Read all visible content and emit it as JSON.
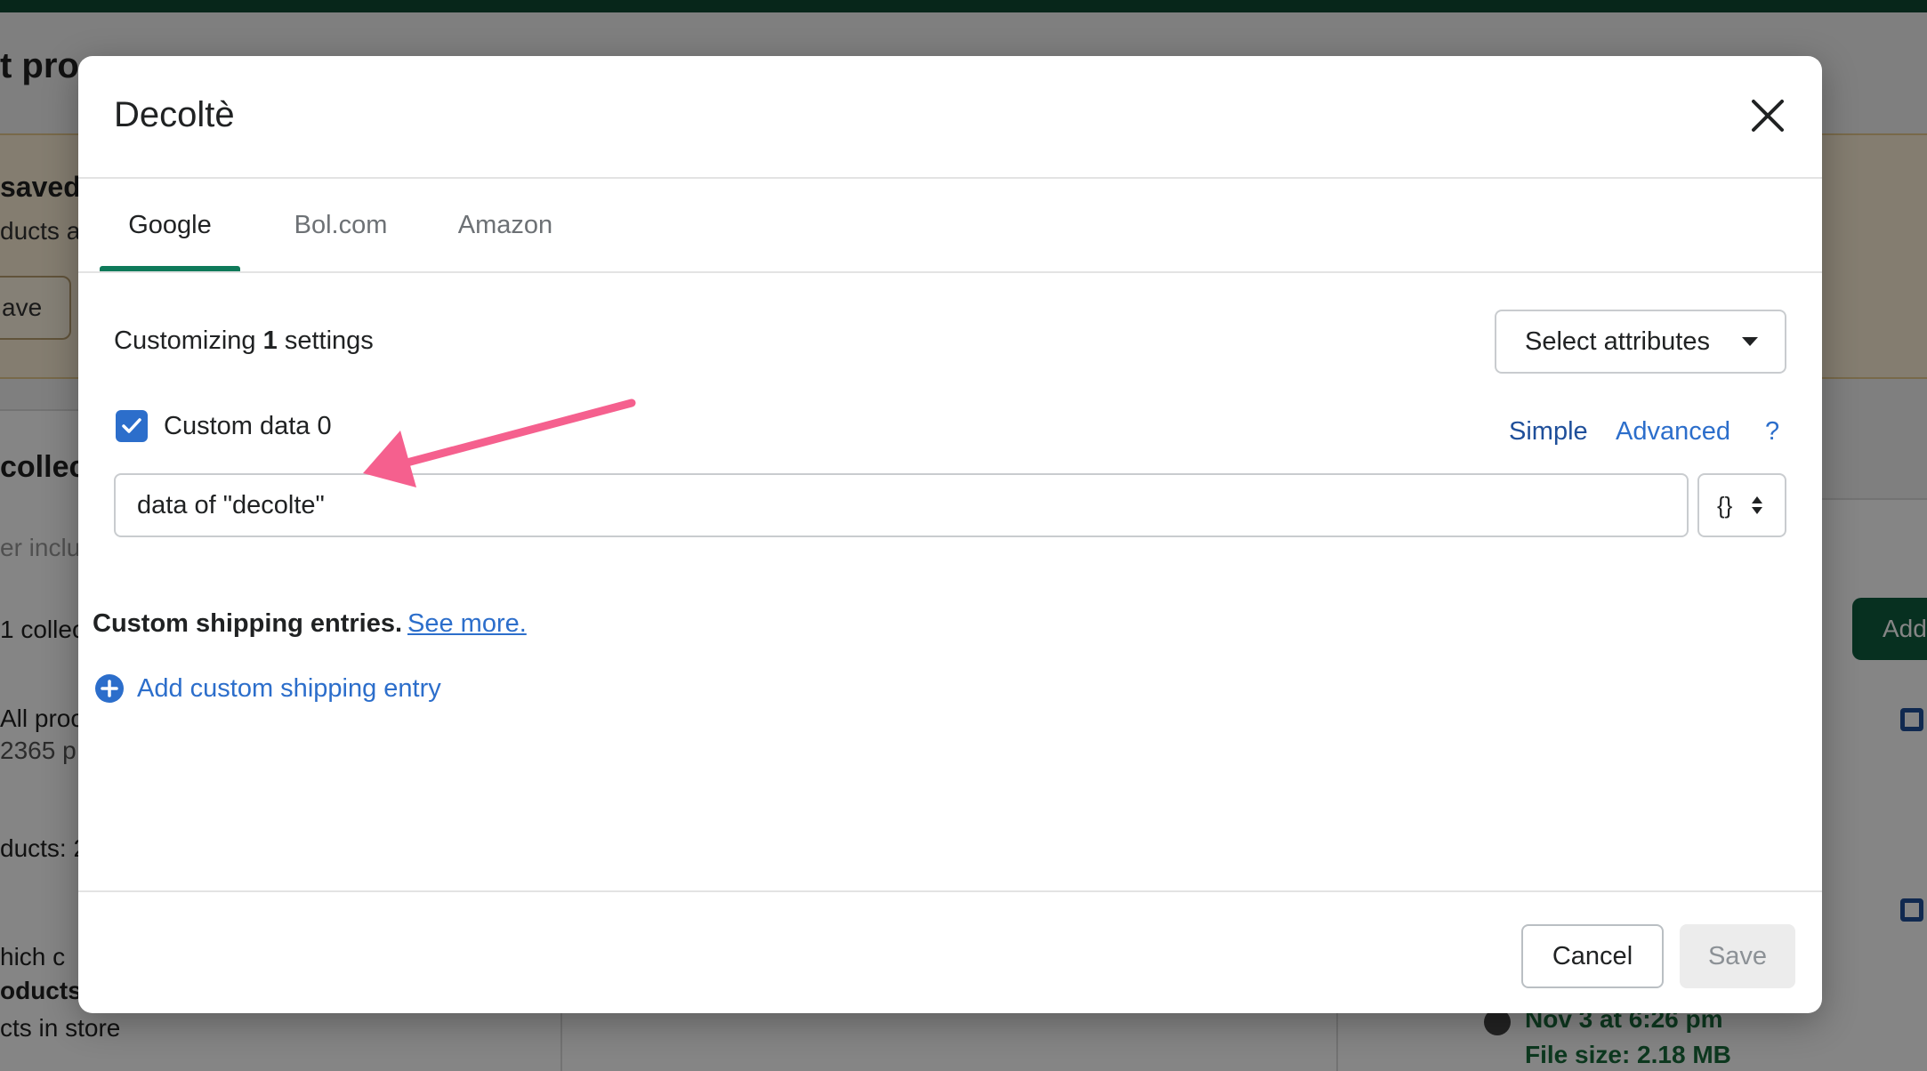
{
  "background": {
    "title_fragment": "t pro",
    "banner_saved": "saved",
    "banner_products": "ducts a",
    "banner_save_button": "ave",
    "collections_heading": "collec",
    "search_hint": "er inclu",
    "collections_count": "1 collec",
    "all_products": "All proc",
    "products_count": "2365 p",
    "products_label": "ducts: 2",
    "which_text": "hich c",
    "products_bold": "oducts",
    "products_in_store": "cts in store",
    "add_button": "Add",
    "date": "Nov 3 at 6:26 pm",
    "file_size": "File size: 2.18 MB"
  },
  "modal": {
    "title": "Decoltè",
    "tabs": [
      {
        "label": "Google",
        "active": true
      },
      {
        "label": "Bol.com",
        "active": false
      },
      {
        "label": "Amazon",
        "active": false
      }
    ],
    "customizing_prefix": "Customizing",
    "customizing_count": "1",
    "customizing_suffix": "settings",
    "select_attributes_label": "Select attributes",
    "custom_data": {
      "checked": true,
      "label": "Custom data 0",
      "value": "data of \"decolte\"",
      "mode_symbol": "{}"
    },
    "mode_links": {
      "simple": "Simple",
      "advanced": "Advanced",
      "help": "?"
    },
    "shipping_text": "Custom shipping entries.",
    "see_more": "See more.",
    "add_entry_label": "Add custom shipping entry",
    "footer": {
      "cancel_label": "Cancel",
      "save_label": "Save"
    }
  },
  "colors": {
    "accent_tab": "#0f7a5a",
    "link": "#2c6ecb",
    "checkbox": "#2c6ecb",
    "annotation_arrow": "#f5608e"
  }
}
